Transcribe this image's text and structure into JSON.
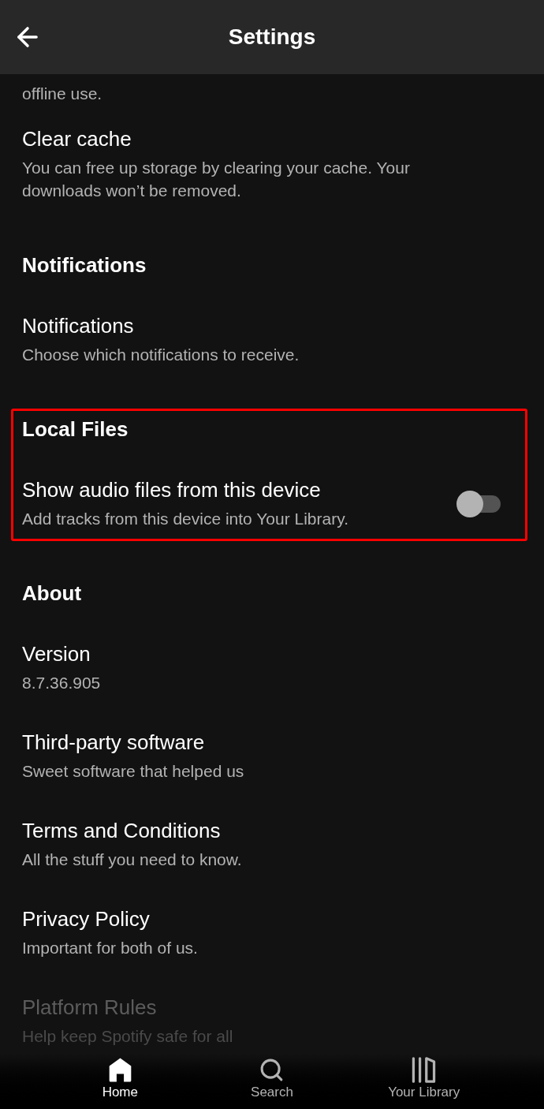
{
  "header": {
    "title": "Settings"
  },
  "sections": [
    {
      "highlighted": false,
      "items": [
        {
          "kind": "text",
          "subtitle": "offline use."
        },
        {
          "kind": "text",
          "title": "Clear cache",
          "subtitle": "You can free up storage by clearing your cache. Your downloads won’t be removed."
        }
      ]
    },
    {
      "heading": "Notifications",
      "highlighted": false,
      "items": [
        {
          "kind": "text",
          "title": "Notifications",
          "subtitle": "Choose which notifications to receive."
        }
      ]
    },
    {
      "heading": "Local Files",
      "highlighted": true,
      "items": [
        {
          "kind": "toggle",
          "title": "Show audio files from this device",
          "subtitle": "Add tracks from this device into Your Library.",
          "on": false
        }
      ]
    },
    {
      "heading": "About",
      "highlighted": false,
      "items": [
        {
          "kind": "text",
          "title": "Version",
          "subtitle": "8.7.36.905",
          "faded": false
        },
        {
          "kind": "text",
          "title": "Third-party software",
          "subtitle": "Sweet software that helped us",
          "faded": false
        },
        {
          "kind": "text",
          "title": "Terms and Conditions",
          "subtitle": "All the stuff you need to know.",
          "faded": false
        },
        {
          "kind": "text",
          "title": "Privacy Policy",
          "subtitle": "Important for both of us.",
          "faded": false
        },
        {
          "kind": "text",
          "title": "Platform Rules",
          "subtitle": "Help keep Spotify safe for all",
          "faded": true
        }
      ]
    }
  ],
  "nav": [
    {
      "label": "Home",
      "selected": true
    },
    {
      "label": "Search",
      "selected": false
    },
    {
      "label": "Your Library",
      "selected": false
    }
  ]
}
